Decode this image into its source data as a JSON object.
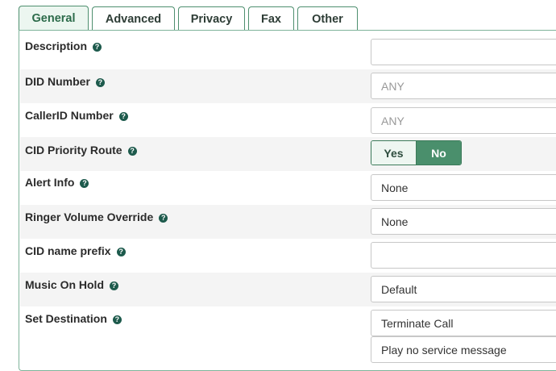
{
  "tabs": [
    "General",
    "Advanced",
    "Privacy",
    "Fax",
    "Other"
  ],
  "fields": {
    "description": {
      "label": "Description",
      "value": "",
      "placeholder": ""
    },
    "did_number": {
      "label": "DID Number",
      "value": "",
      "placeholder": "ANY"
    },
    "callerid_number": {
      "label": "CallerID Number",
      "value": "",
      "placeholder": "ANY"
    },
    "cid_priority_route": {
      "label": "CID Priority Route",
      "yes": "Yes",
      "no": "No",
      "selected": "No"
    },
    "alert_info": {
      "label": "Alert Info",
      "value": "None"
    },
    "ringer_volume_override": {
      "label": "Ringer Volume Override",
      "value": "None"
    },
    "cid_name_prefix": {
      "label": "CID name prefix",
      "value": "",
      "placeholder": ""
    },
    "music_on_hold": {
      "label": "Music On Hold",
      "value": "Default"
    },
    "set_destination": {
      "label": "Set Destination",
      "value": "Terminate Call",
      "sub_value": "Play no service message"
    }
  },
  "help_glyph": "?",
  "colors": {
    "accent": "#4a8f6c",
    "tab_active_bg": "#ecf6f0",
    "help_icon": "#1d5a4c",
    "row_shade": "#f4f4f4"
  }
}
